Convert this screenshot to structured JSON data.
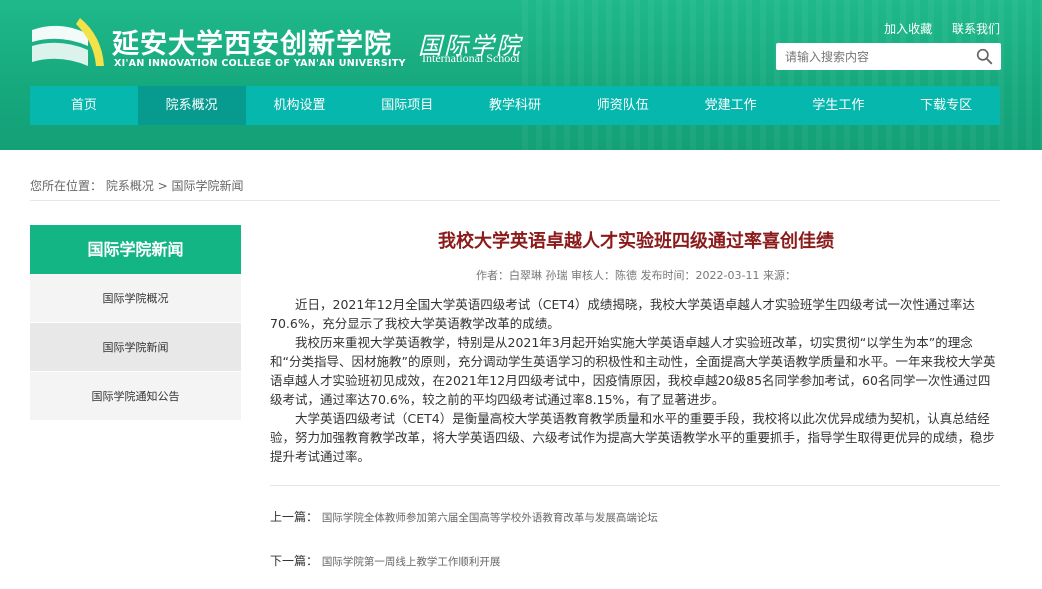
{
  "header": {
    "school_cn": "延安大学西安创新学院",
    "school_en": "XI'AN INNOVATION COLLEGE OF YAN'AN UNIVERSITY",
    "intl_cn": "国际学院",
    "intl_en": "International School",
    "toplinks": [
      "加入收藏",
      "联系我们"
    ],
    "search_placeholder": "请输入搜索内容"
  },
  "nav": [
    "首页",
    "院系概况",
    "机构设置",
    "国际项目",
    "教学科研",
    "师资队伍",
    "党建工作",
    "学生工作",
    "下载专区"
  ],
  "breadcrumb": {
    "prefix": "您所在位置：",
    "path": "院系概况 > 国际学院新闻"
  },
  "sidebar": {
    "title": "国际学院新闻",
    "items": [
      "国际学院概况",
      "国际学院新闻",
      "国际学院通知公告"
    ]
  },
  "article": {
    "title": "我校大学英语卓越人才实验班四级通过率喜创佳绩",
    "meta": "作者：白翠琳 孙瑞  审核人：陈德  发布时间：2022-03-11  来源：",
    "paragraphs": [
      "近日，2021年12月全国大学英语四级考试（CET4）成绩揭晓，我校大学英语卓越人才实验班学生四级考试一次性通过率达70.6%，充分显示了我校大学英语教学改革的成绩。",
      "我校历来重视大学英语教学，特别是从2021年3月起开始实施大学英语卓越人才实验班改革，切实贯彻“以学生为本”的理念和“分类指导、因材施教”的原则，充分调动学生英语学习的积极性和主动性，全面提高大学英语教学质量和水平。一年来我校大学英语卓越人才实验班初见成效，在2021年12月四级考试中，因疫情原因，我校卓越20级85名同学参加考试，60名同学一次性通过四级考试，通过率达70.6%，较之前的平均四级考试通过率8.15%，有了显著进步。",
      "大学英语四级考试（CET4）是衡量高校大学英语教育教学质量和水平的重要手段，我校将以此次优异成绩为契机，认真总结经验，努力加强教育教学改革，将大学英语四级、六级考试作为提高大学英语教学水平的重要抓手，指导学生取得更优异的成绩，稳步提升考试通过率。"
    ],
    "prev_label": "上一篇：",
    "prev_title": "国际学院全体教师参加第六届全国高等学校外语教育改革与发展高端论坛",
    "next_label": "下一篇：",
    "next_title": "国际学院第一周线上教学工作顺利开展"
  },
  "colors": {
    "banner_green": "#16a87d",
    "nav_teal": "#06b7ad",
    "nav_active": "#079a8f",
    "sidebar_head": "#14b585",
    "title_red": "#8b1a1a"
  }
}
